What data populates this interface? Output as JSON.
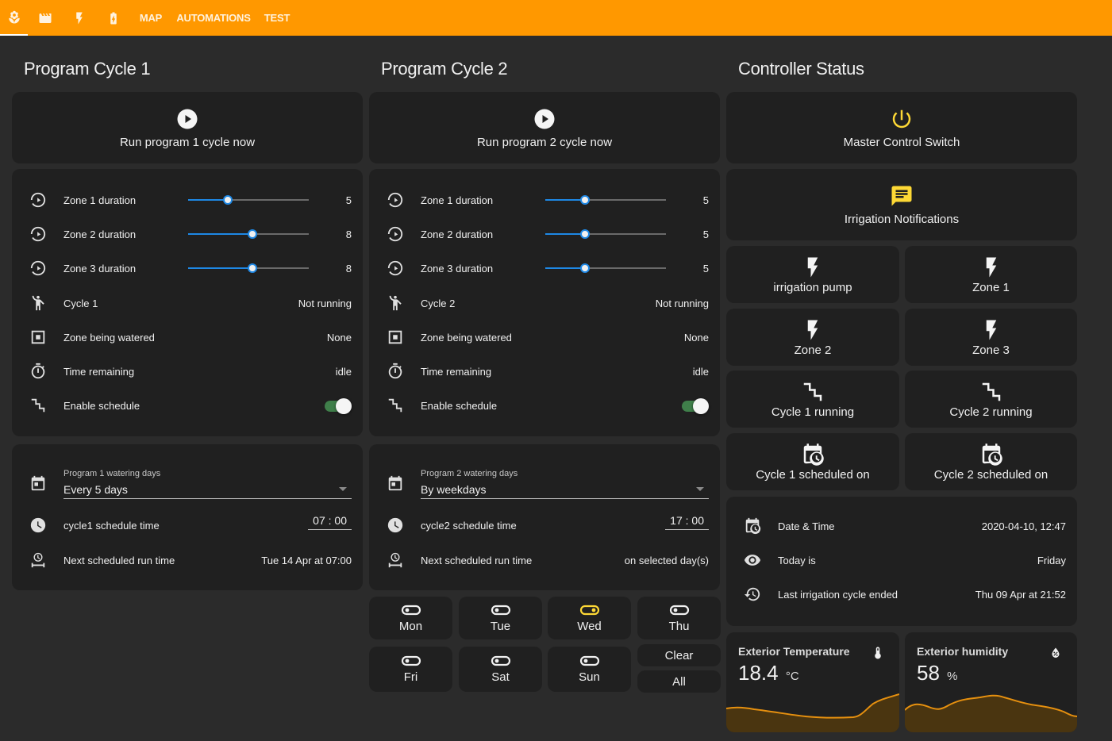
{
  "topbar": {
    "tabs": [
      "MAP",
      "AUTOMATIONS",
      "TEST"
    ]
  },
  "colors": {
    "accent": "#ff9800",
    "slider": "#1e88e5",
    "toggle_on": "#3f7f4a",
    "highlight": "#fdd835",
    "graph": "#e6900f"
  },
  "columns": {
    "col1_title": "Program Cycle 1",
    "col2_title": "Program Cycle 2",
    "col3_title": "Controller Status"
  },
  "program1": {
    "run_label": "Run program 1 cycle now",
    "zones": [
      {
        "label": "Zone 1 duration",
        "value": "5",
        "level": 0.33
      },
      {
        "label": "Zone 2 duration",
        "value": "8",
        "level": 0.53
      },
      {
        "label": "Zone 3 duration",
        "value": "8",
        "level": 0.53
      }
    ],
    "cycle_label": "Cycle 1",
    "cycle_state": "Not running",
    "zone_watered_label": "Zone being watered",
    "zone_watered_value": "None",
    "time_remaining_label": "Time remaining",
    "time_remaining_value": "idle",
    "enable_label": "Enable schedule",
    "enable_on": true,
    "days_caption": "Program 1 watering days",
    "days_value": "Every 5 days",
    "schedule_label": "cycle1 schedule time",
    "schedule_value": "07 : 00",
    "next_label": "Next scheduled run time",
    "next_value": "Tue 14 Apr at 07:00"
  },
  "program2": {
    "run_label": "Run program 2 cycle now",
    "zones": [
      {
        "label": "Zone 1 duration",
        "value": "5",
        "level": 0.33
      },
      {
        "label": "Zone 2 duration",
        "value": "5",
        "level": 0.33
      },
      {
        "label": "Zone 3 duration",
        "value": "5",
        "level": 0.33
      }
    ],
    "cycle_label": "Cycle 2",
    "cycle_state": "Not running",
    "zone_watered_label": "Zone being watered",
    "zone_watered_value": "None",
    "time_remaining_label": "Time remaining",
    "time_remaining_value": "idle",
    "enable_label": "Enable schedule",
    "enable_on": true,
    "days_caption": "Program 2 watering days",
    "days_value": "By weekdays",
    "schedule_label": "cycle2 schedule time",
    "schedule_value": "17 : 00",
    "next_label": "Next scheduled run time",
    "next_value": "on selected day(s)"
  },
  "weekdays": {
    "days": [
      {
        "label": "Mon",
        "on": false
      },
      {
        "label": "Tue",
        "on": false
      },
      {
        "label": "Wed",
        "on": true
      },
      {
        "label": "Thu",
        "on": false
      },
      {
        "label": "Fri",
        "on": false
      },
      {
        "label": "Sat",
        "on": false
      },
      {
        "label": "Sun",
        "on": false
      }
    ],
    "clear_label": "Clear",
    "all_label": "All"
  },
  "controller": {
    "master_label": "Master Control Switch",
    "notifications_label": "Irrigation Notifications",
    "pump_label": "irrigation pump",
    "zone1_label": "Zone 1",
    "zone2_label": "Zone 2",
    "zone3_label": "Zone 3",
    "cycle1_running": "Cycle 1 running",
    "cycle2_running": "Cycle 2 running",
    "cycle1_scheduled": "Cycle 1 scheduled on",
    "cycle2_scheduled": "Cycle 2 scheduled on",
    "datetime_label": "Date & Time",
    "datetime_value": "2020-04-10, 12:47",
    "today_label": "Today is",
    "today_value": "Friday",
    "last_label": "Last irrigation cycle ended",
    "last_value": "Thu 09 Apr at 21:52"
  },
  "sensors": {
    "temp_title": "Exterior Temperature",
    "temp_value": "18.4",
    "temp_unit": "°C",
    "hum_title": "Exterior humidity",
    "hum_value": "58",
    "hum_unit": "%"
  }
}
